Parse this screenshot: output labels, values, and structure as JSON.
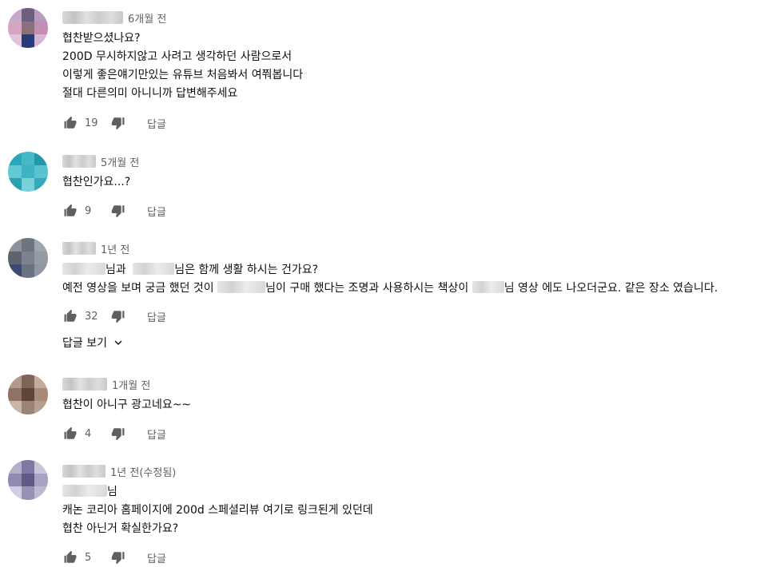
{
  "comments": [
    {
      "time": "6개월 전",
      "lines": [
        "협찬받으셨나요?",
        "200D 무시하지않고 사려고 생각하던 사람으로서",
        "이렇게 좋은얘기만있는 유튜브 처음봐서 여쭤봅니다",
        "절대 다른의미 아니니까 답변해주세요"
      ],
      "likes": "19",
      "reply_label": "답글"
    },
    {
      "time": "5개월 전",
      "lines": [
        "협찬인가요...?"
      ],
      "likes": "9",
      "reply_label": "답글"
    },
    {
      "time": "1년 전",
      "line1_part1": "님과",
      "line1_part2": "님은 함께 생활 하시는 건가요?",
      "line2_part1": "예전 영상을 보며 궁금 했던 것이",
      "line2_part2": "님이 구매 했다는 조명과 사용하시는 책상이",
      "line2_part3": "님 영상 에도 나오더군요. 같은 장소 였습니다.",
      "likes": "32",
      "reply_label": "답글",
      "view_replies_label": "답글 보기"
    },
    {
      "time": "1개월 전",
      "lines": [
        "협찬이 아니구 광고네요~~"
      ],
      "likes": "4",
      "reply_label": "답글"
    },
    {
      "time": "1년 전(수정됨)",
      "line1": "님",
      "lines": [
        "캐논  코리아 홈페이지에 200d 스페셜리뷰 여기로 링크된게 있던데",
        "협찬 아닌거 확실한가요?"
      ],
      "likes": "5",
      "reply_label": "답글"
    }
  ],
  "icons": {
    "like": "thumbs-up-icon",
    "dislike": "thumbs-down-icon",
    "expand": "chevron-down-icon"
  }
}
